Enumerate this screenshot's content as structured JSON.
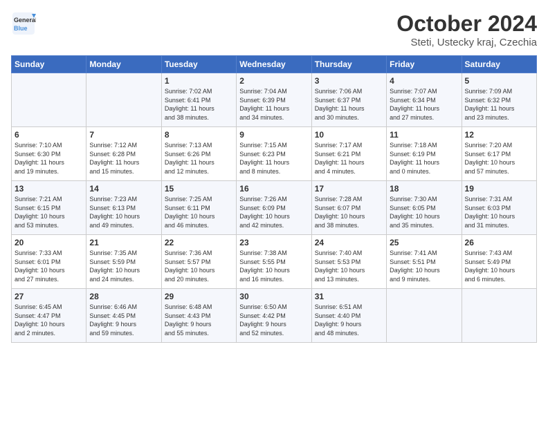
{
  "header": {
    "logo_line1": "General",
    "logo_line2": "Blue",
    "month": "October 2024",
    "location": "Steti, Ustecky kraj, Czechia"
  },
  "weekdays": [
    "Sunday",
    "Monday",
    "Tuesday",
    "Wednesday",
    "Thursday",
    "Friday",
    "Saturday"
  ],
  "weeks": [
    [
      {
        "day": "",
        "info": ""
      },
      {
        "day": "",
        "info": ""
      },
      {
        "day": "1",
        "info": "Sunrise: 7:02 AM\nSunset: 6:41 PM\nDaylight: 11 hours\nand 38 minutes."
      },
      {
        "day": "2",
        "info": "Sunrise: 7:04 AM\nSunset: 6:39 PM\nDaylight: 11 hours\nand 34 minutes."
      },
      {
        "day": "3",
        "info": "Sunrise: 7:06 AM\nSunset: 6:37 PM\nDaylight: 11 hours\nand 30 minutes."
      },
      {
        "day": "4",
        "info": "Sunrise: 7:07 AM\nSunset: 6:34 PM\nDaylight: 11 hours\nand 27 minutes."
      },
      {
        "day": "5",
        "info": "Sunrise: 7:09 AM\nSunset: 6:32 PM\nDaylight: 11 hours\nand 23 minutes."
      }
    ],
    [
      {
        "day": "6",
        "info": "Sunrise: 7:10 AM\nSunset: 6:30 PM\nDaylight: 11 hours\nand 19 minutes."
      },
      {
        "day": "7",
        "info": "Sunrise: 7:12 AM\nSunset: 6:28 PM\nDaylight: 11 hours\nand 15 minutes."
      },
      {
        "day": "8",
        "info": "Sunrise: 7:13 AM\nSunset: 6:26 PM\nDaylight: 11 hours\nand 12 minutes."
      },
      {
        "day": "9",
        "info": "Sunrise: 7:15 AM\nSunset: 6:23 PM\nDaylight: 11 hours\nand 8 minutes."
      },
      {
        "day": "10",
        "info": "Sunrise: 7:17 AM\nSunset: 6:21 PM\nDaylight: 11 hours\nand 4 minutes."
      },
      {
        "day": "11",
        "info": "Sunrise: 7:18 AM\nSunset: 6:19 PM\nDaylight: 11 hours\nand 0 minutes."
      },
      {
        "day": "12",
        "info": "Sunrise: 7:20 AM\nSunset: 6:17 PM\nDaylight: 10 hours\nand 57 minutes."
      }
    ],
    [
      {
        "day": "13",
        "info": "Sunrise: 7:21 AM\nSunset: 6:15 PM\nDaylight: 10 hours\nand 53 minutes."
      },
      {
        "day": "14",
        "info": "Sunrise: 7:23 AM\nSunset: 6:13 PM\nDaylight: 10 hours\nand 49 minutes."
      },
      {
        "day": "15",
        "info": "Sunrise: 7:25 AM\nSunset: 6:11 PM\nDaylight: 10 hours\nand 46 minutes."
      },
      {
        "day": "16",
        "info": "Sunrise: 7:26 AM\nSunset: 6:09 PM\nDaylight: 10 hours\nand 42 minutes."
      },
      {
        "day": "17",
        "info": "Sunrise: 7:28 AM\nSunset: 6:07 PM\nDaylight: 10 hours\nand 38 minutes."
      },
      {
        "day": "18",
        "info": "Sunrise: 7:30 AM\nSunset: 6:05 PM\nDaylight: 10 hours\nand 35 minutes."
      },
      {
        "day": "19",
        "info": "Sunrise: 7:31 AM\nSunset: 6:03 PM\nDaylight: 10 hours\nand 31 minutes."
      }
    ],
    [
      {
        "day": "20",
        "info": "Sunrise: 7:33 AM\nSunset: 6:01 PM\nDaylight: 10 hours\nand 27 minutes."
      },
      {
        "day": "21",
        "info": "Sunrise: 7:35 AM\nSunset: 5:59 PM\nDaylight: 10 hours\nand 24 minutes."
      },
      {
        "day": "22",
        "info": "Sunrise: 7:36 AM\nSunset: 5:57 PM\nDaylight: 10 hours\nand 20 minutes."
      },
      {
        "day": "23",
        "info": "Sunrise: 7:38 AM\nSunset: 5:55 PM\nDaylight: 10 hours\nand 16 minutes."
      },
      {
        "day": "24",
        "info": "Sunrise: 7:40 AM\nSunset: 5:53 PM\nDaylight: 10 hours\nand 13 minutes."
      },
      {
        "day": "25",
        "info": "Sunrise: 7:41 AM\nSunset: 5:51 PM\nDaylight: 10 hours\nand 9 minutes."
      },
      {
        "day": "26",
        "info": "Sunrise: 7:43 AM\nSunset: 5:49 PM\nDaylight: 10 hours\nand 6 minutes."
      }
    ],
    [
      {
        "day": "27",
        "info": "Sunrise: 6:45 AM\nSunset: 4:47 PM\nDaylight: 10 hours\nand 2 minutes."
      },
      {
        "day": "28",
        "info": "Sunrise: 6:46 AM\nSunset: 4:45 PM\nDaylight: 9 hours\nand 59 minutes."
      },
      {
        "day": "29",
        "info": "Sunrise: 6:48 AM\nSunset: 4:43 PM\nDaylight: 9 hours\nand 55 minutes."
      },
      {
        "day": "30",
        "info": "Sunrise: 6:50 AM\nSunset: 4:42 PM\nDaylight: 9 hours\nand 52 minutes."
      },
      {
        "day": "31",
        "info": "Sunrise: 6:51 AM\nSunset: 4:40 PM\nDaylight: 9 hours\nand 48 minutes."
      },
      {
        "day": "",
        "info": ""
      },
      {
        "day": "",
        "info": ""
      }
    ]
  ]
}
